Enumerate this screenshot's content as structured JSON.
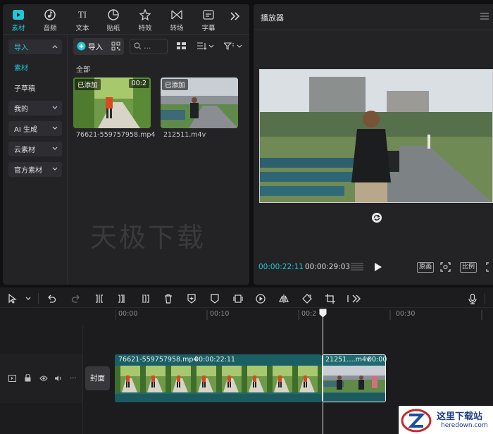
{
  "media_tabs": [
    {
      "label": "素材",
      "icon": "media-icon",
      "active": true
    },
    {
      "label": "音频",
      "icon": "audio-icon"
    },
    {
      "label": "文本",
      "icon": "text-icon"
    },
    {
      "label": "贴纸",
      "icon": "sticker-icon"
    },
    {
      "label": "特效",
      "icon": "effects-icon"
    },
    {
      "label": "转场",
      "icon": "transition-icon"
    },
    {
      "label": "字幕",
      "icon": "captions-icon"
    }
  ],
  "sidebar": {
    "import": "导入",
    "items": [
      "素材",
      "子草稿"
    ],
    "groups": [
      "我的",
      "AI 生成",
      "云素材",
      "官方素材"
    ]
  },
  "toolbar": {
    "import_button": "导入",
    "search_placeholder": "..."
  },
  "library": {
    "section": "全部",
    "clips": [
      {
        "badge": "已添加",
        "duration": "00:2",
        "name": "76621-559757958.mp4"
      },
      {
        "badge": "已添加",
        "duration": "",
        "name": "212511.m4v"
      }
    ]
  },
  "watermark": "天极下载",
  "player": {
    "title": "播放器",
    "current_time": "00:00:22:11",
    "total_time": "00:00:29:03",
    "original_btn": "原画",
    "ratio_btn": "比例"
  },
  "timeline": {
    "ruler": [
      "00:00",
      "00:10",
      "00:2",
      "00:30"
    ],
    "cover": "封面",
    "clip1": {
      "name": "76621-559757958.mp4",
      "duration": "00:00:22:11"
    },
    "clip2": {
      "name": "21251….m4v",
      "duration": "00:00"
    }
  },
  "logo": {
    "title": "这里下载站",
    "url": "heredown.com"
  },
  "colors": {
    "accent": "#22c6d4",
    "clip_bg": "#1e6b70",
    "panel": "#232326"
  }
}
